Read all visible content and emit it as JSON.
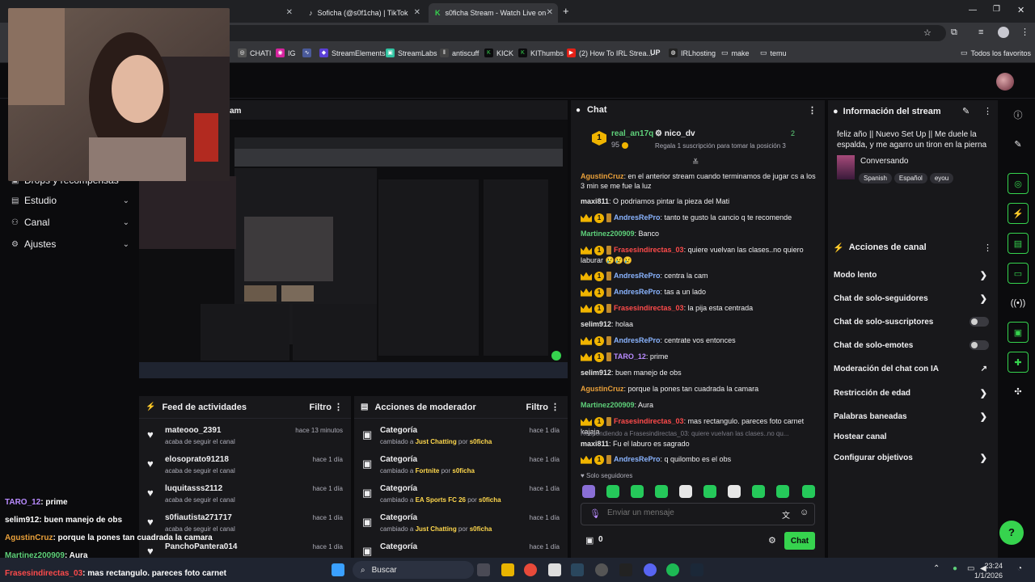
{
  "browser": {
    "tabs": [
      {
        "label": "Soficha (@s0f1cha) | TikTok",
        "icon": "tiktok-icon"
      },
      {
        "label": "s0ficha Stream - Watch Live on",
        "icon": "kick-icon"
      }
    ],
    "new_tab": "+",
    "bookmarks": [
      "CHATI",
      "IG",
      "StreamElements",
      "StreamLabs",
      "antiscuff",
      "KICK",
      "KIThumbs",
      "(2) How To IRL Strea...",
      "IRLhosting",
      "make",
      "temu"
    ],
    "bookmarks_up": "UP",
    "all_favorites": "Todos los favoritos"
  },
  "sidebar": {
    "partial_item": "Drops y recompensas",
    "items": [
      {
        "label": "Estudio",
        "icon": "studio-icon"
      },
      {
        "label": "Canal",
        "icon": "channel-icon"
      },
      {
        "label": "Ajustes",
        "icon": "gear-icon"
      }
    ]
  },
  "preview": {
    "header_partial": "am"
  },
  "feed": {
    "title": "Feed de actividades",
    "filter": "Filtro",
    "rows": [
      {
        "name": "mateooo_2391",
        "sub": "acaba de seguir el canal",
        "time": "hace 13 minutos"
      },
      {
        "name": "elosoprato91218",
        "sub": "acaba de seguir el canal",
        "time": "hace 1 día"
      },
      {
        "name": "luquitasss2112",
        "sub": "acaba de seguir el canal",
        "time": "hace 1 día"
      },
      {
        "name": "s0fiautista271717",
        "sub": "acaba de seguir el canal",
        "time": "hace 1 día"
      },
      {
        "name": "PanchoPantera014",
        "sub": "",
        "time": "hace 1 día"
      }
    ]
  },
  "mod": {
    "title": "Acciones de moderador",
    "filter": "Filtro",
    "rows": [
      {
        "name": "Categoría",
        "pre": "cambiado a ",
        "game": "Just Chatting",
        "mid": " por ",
        "by": "s0ficha",
        "time": "hace 1 día"
      },
      {
        "name": "Categoría",
        "pre": "cambiado a ",
        "game": "Fortnite",
        "mid": " por ",
        "by": "s0ficha",
        "time": "hace 1 día"
      },
      {
        "name": "Categoría",
        "pre": "cambiado a ",
        "game": "EA Sports FC 26",
        "mid": " por ",
        "by": "s0ficha",
        "time": "hace 1 día"
      },
      {
        "name": "Categoría",
        "pre": "cambiado a ",
        "game": "Just Chatting",
        "mid": " por ",
        "by": "s0ficha",
        "time": "hace 1 día"
      },
      {
        "name": "Categoría",
        "pre": "",
        "game": "",
        "mid": "",
        "by": "",
        "time": "hace 1 día"
      }
    ]
  },
  "chat": {
    "title": "Chat",
    "leader": {
      "rank": "1",
      "name": "real_an17q",
      "points": "95",
      "sub_user": "nico_dv",
      "sub_count": "2",
      "sub_text": "Regala 1 suscripción para tomar la posición 3"
    },
    "messages": [
      {
        "user": "AgustinCruz",
        "color": "u-orange",
        "badges": false,
        "text": ": en el anterior stream cuando terminamos de jugar cs a los 3 min se me fue la luz"
      },
      {
        "user": "maxi811",
        "color": "u-white",
        "badges": false,
        "text": ": O podriamos pintar la pieza del Mati"
      },
      {
        "user": "AndresRePro",
        "color": "u-blue",
        "badges": true,
        "text": ": tanto te gusto la cancio q te recomende"
      },
      {
        "user": "Martinez200909",
        "color": "u-green",
        "badges": false,
        "text": ": Banco"
      },
      {
        "user": "Frasesindirectas_03",
        "color": "u-red",
        "badges": true,
        "text": ": quiere vuelvan las clases..no quiero laburar 😢😢😢"
      },
      {
        "user": "AndresRePro",
        "color": "u-blue",
        "badges": true,
        "text": ": centra la cam"
      },
      {
        "user": "AndresRePro",
        "color": "u-blue",
        "badges": true,
        "text": ": tas a un lado"
      },
      {
        "user": "Frasesindirectas_03",
        "color": "u-red",
        "badges": true,
        "text": ": la pija esta centrada"
      },
      {
        "user": "selim912",
        "color": "u-white",
        "badges": false,
        "text": ": holaa"
      },
      {
        "user": "AndresRePro",
        "color": "u-blue",
        "badges": true,
        "text": ": centrate vos entonces"
      },
      {
        "user": "TARO_12",
        "color": "u-purple",
        "badges": true,
        "text": ": prime"
      },
      {
        "user": "selim912",
        "color": "u-white",
        "badges": false,
        "text": ": buen manejo de obs"
      },
      {
        "user": "AgustinCruz",
        "color": "u-orange",
        "badges": false,
        "text": ": porque la pones tan cuadrada la camara"
      },
      {
        "user": "Martinez200909",
        "color": "u-green",
        "badges": false,
        "text": ": Aura"
      },
      {
        "user": "Frasesindirectas_03",
        "color": "u-red",
        "badges": true,
        "text": ": mas rectangulo. pareces foto carnet kajaja"
      },
      {
        "user": "maxi811",
        "color": "u-white",
        "badges": false,
        "text": ": Fu el laburo es sagrado",
        "reply": "Respondiendo a Frasesindirectas_03: quiere vuelvan las clases..no qu..."
      },
      {
        "user": "AndresRePro",
        "color": "u-blue",
        "badges": true,
        "text": ": q quilombo es el obs"
      }
    ],
    "solo_seguidores": "Solo seguidores",
    "input_placeholder": "Enviar un mensaje",
    "points": "0",
    "send": "Chat"
  },
  "info": {
    "title": "Información del stream",
    "stream_title": "feliz año || Nuevo Set Up || Me duele la espalda, y me agarro un tiron en la pierna",
    "category": "Conversando",
    "tags": [
      "Spanish",
      "Español",
      "eyou"
    ]
  },
  "actions": {
    "title": "Acciones de canal",
    "rows": [
      {
        "label": "Modo lento",
        "kind": "chev"
      },
      {
        "label": "Chat de solo-seguidores",
        "kind": "chev"
      },
      {
        "label": "Chat de solo-suscriptores",
        "kind": "toggle"
      },
      {
        "label": "Chat de solo-emotes",
        "kind": "toggle"
      },
      {
        "label": "Moderación del chat con IA",
        "kind": "ext"
      },
      {
        "label": "Restricción de edad",
        "kind": "chev"
      },
      {
        "label": "Palabras baneadas",
        "kind": "chev"
      },
      {
        "label": "Hostear canal",
        "kind": "none"
      },
      {
        "label": "Configurar objetivos",
        "kind": "chev"
      }
    ]
  },
  "overlay_chat": [
    {
      "user": "TARO_12",
      "color": "#b98bff",
      "text": ": prime"
    },
    {
      "user": "selim912",
      "color": "#ffffff",
      "text": ": buen manejo de obs"
    },
    {
      "user": "AgustinCruz",
      "color": "#e9a03a",
      "text": ": porque la pones tan cuadrada la camara"
    },
    {
      "user": "Martinez200909",
      "color": "#5ed07a",
      "text": ": Aura"
    },
    {
      "user": "Frasesindirectas_03",
      "color": "#ff4b4b",
      "text": ": mas rectangulo. pareces foto carnet"
    }
  ],
  "taskbar": {
    "search": "Buscar",
    "time": "23:24",
    "date": "1/1/2026"
  },
  "colors": {
    "accent": "#36d34e",
    "panel": "#18181b",
    "bg": "#0b0b0d"
  }
}
